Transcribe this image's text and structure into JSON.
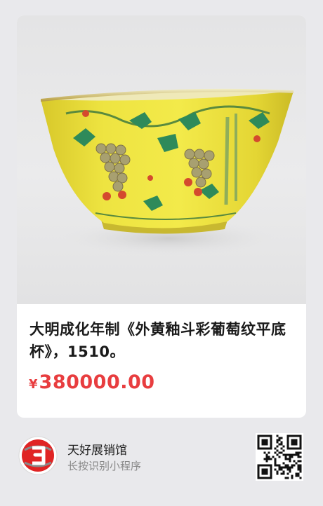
{
  "product": {
    "title": "大明成化年制《外黄釉斗彩葡萄纹平底杯》，1510。",
    "currency_symbol": "¥",
    "price": "380000.00",
    "price_color": "#e83d3f"
  },
  "footer": {
    "app_name": "天好展销馆",
    "hint": "长按识别小程序",
    "logo_icon": "app-logo-icon",
    "qr_icon": "qr-code-icon"
  }
}
